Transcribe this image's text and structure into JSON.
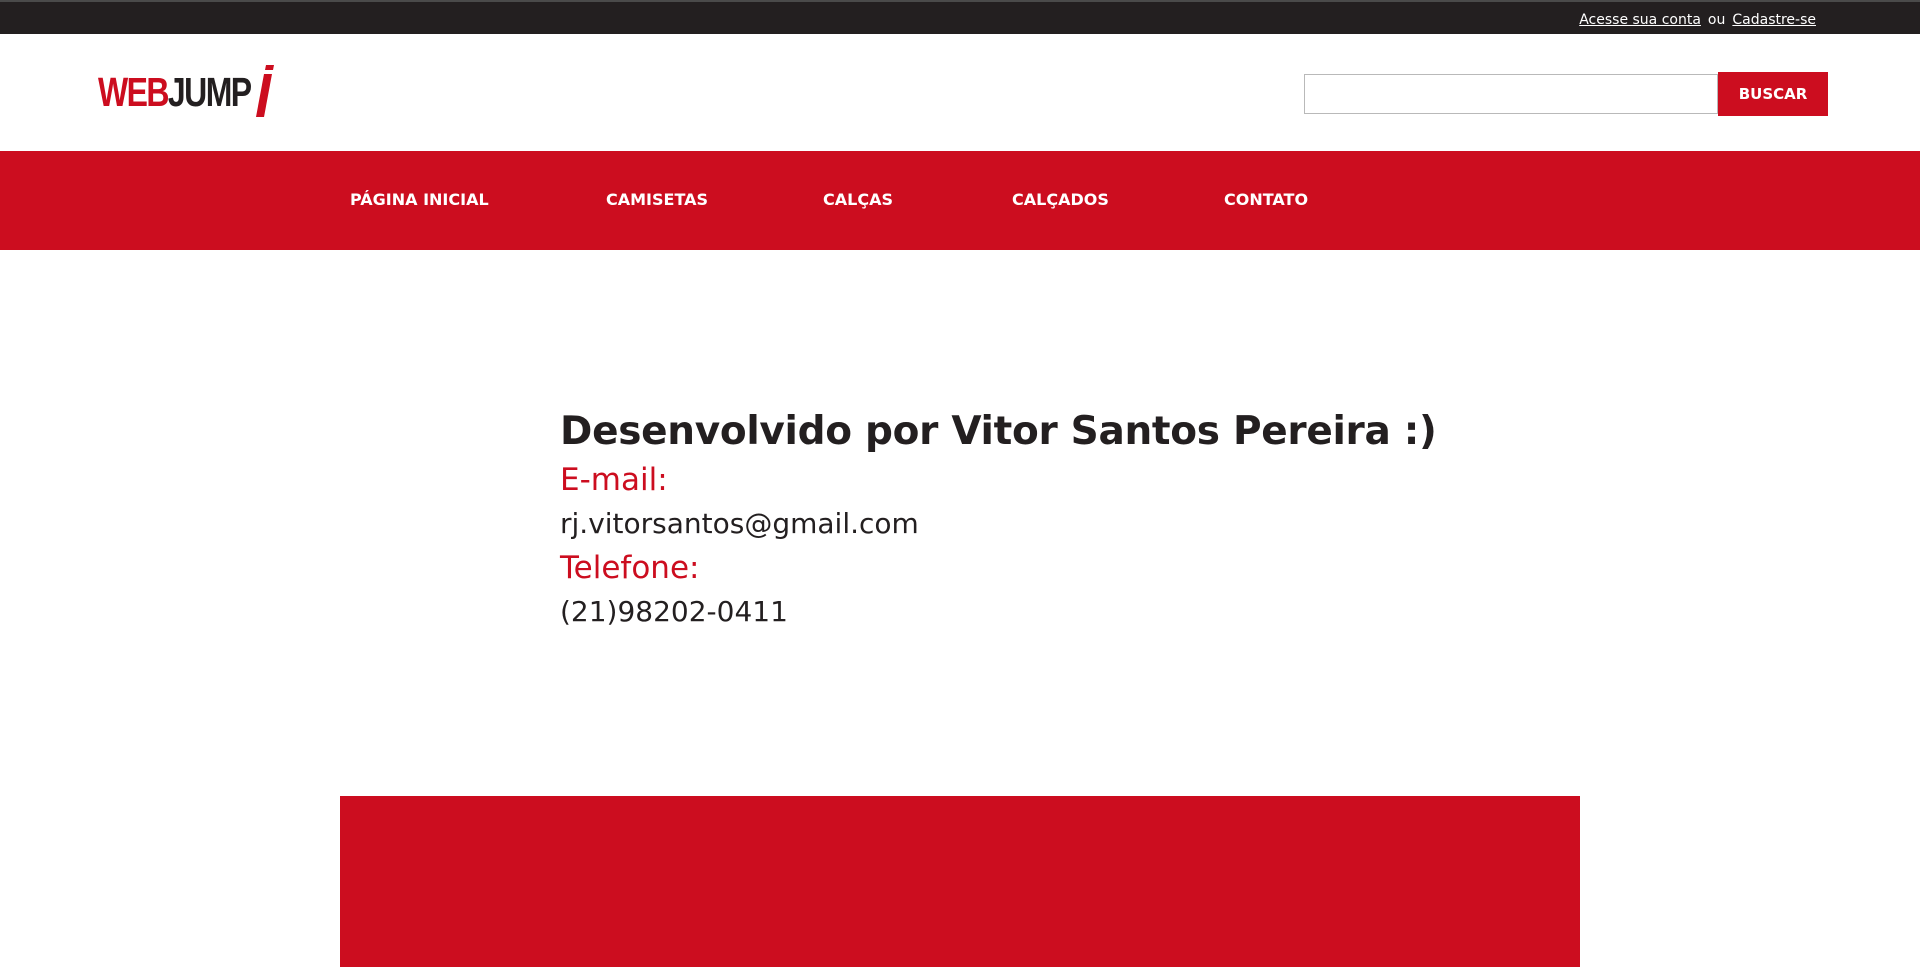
{
  "topbar": {
    "login_link": "Acesse sua conta",
    "separator": "ou",
    "register_link": "Cadastre-se"
  },
  "header": {
    "logo_part1": "WEB",
    "logo_part2": "JUMP",
    "search": {
      "value": "",
      "placeholder": "",
      "button_label": "BUSCAR"
    }
  },
  "nav": {
    "items": [
      {
        "label": "PÁGINA INICIAL"
      },
      {
        "label": "CAMISETAS"
      },
      {
        "label": "CALÇAS"
      },
      {
        "label": "CALÇADOS"
      },
      {
        "label": "CONTATO"
      }
    ]
  },
  "main": {
    "title": "Desenvolvido por Vitor Santos Pereira :)",
    "email_label": "E-mail:",
    "email_value": "rj.vitorsantos@gmail.com",
    "phone_label": "Telefone:",
    "phone_value": "(21)98202-0411"
  },
  "colors": {
    "brand_red": "#cc0d1f",
    "dark": "#231f20",
    "white": "#ffffff"
  }
}
